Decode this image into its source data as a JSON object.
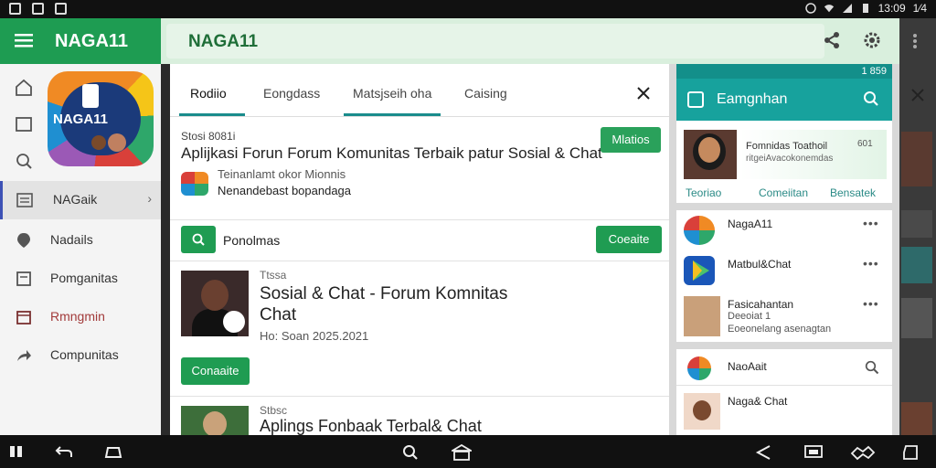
{
  "status_bar": {
    "time": "13:09"
  },
  "app_bar": {
    "app_name": "NAGA11",
    "title": "NAGA11"
  },
  "sidebar": {
    "logo_text": "NAGA11",
    "items": [
      {
        "label": "NAGaik"
      },
      {
        "label": "Nadails"
      },
      {
        "label": "Pomganitas"
      },
      {
        "label": "Rmngmin"
      },
      {
        "label": "Compunitas"
      }
    ]
  },
  "tabs": [
    {
      "label": "Rodiio"
    },
    {
      "label": "Eongdass"
    },
    {
      "label": "Matsjseih oha"
    },
    {
      "label": "Caising"
    }
  ],
  "featured": {
    "label": "Stosi 8081i",
    "headline": "Aplijkasi Forun Forum Komunitas Terbaik patur Sosial & Chat",
    "badge": "Mlatios",
    "sub1": "Teinanlamt okor Mionnis",
    "sub2": "Nenandebast bopandaga"
  },
  "search_row": {
    "text": "Ponolmas",
    "button": "Coeaite"
  },
  "post": {
    "kicker": "Ttssa",
    "title": "Sosial & Chat - Forum Komnitas Chat",
    "meta": "Ho: Soan 2025.2021",
    "button": "Conaaite"
  },
  "post2": {
    "kicker": "Stbsc",
    "title": "Aplings Fonbaak Terbal& Chat"
  },
  "right_panel": {
    "status_time": "1 859",
    "header_title": "Eamgnhan",
    "card1": {
      "line1": "Fomnidas Toathoil",
      "line2": "ritgeiAvacokonemdas",
      "num": "601",
      "links": [
        "Teoriao",
        "Comeiitan",
        "Bensatek"
      ]
    },
    "list": [
      {
        "name": "NagaA11",
        "sub1": "",
        "sub2": ""
      },
      {
        "name": "Matbul&Chat",
        "sub1": "",
        "sub2": ""
      },
      {
        "name": "Fasicahantan",
        "sub1": "Deeoiat 1",
        "sub2": "Eoeonelang asenagtan"
      }
    ],
    "card3": {
      "name": "NaoAait",
      "chat_name": "Naga& Chat"
    }
  }
}
